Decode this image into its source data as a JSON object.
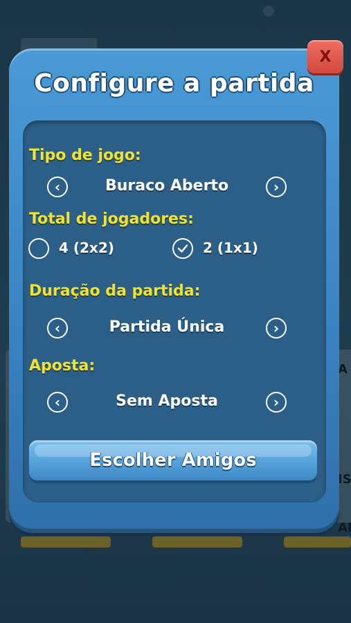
{
  "dialog": {
    "title": "Configure a partida",
    "close_label": "X",
    "game_type": {
      "label": "Tipo de jogo:",
      "value": "Buraco Aberto"
    },
    "players": {
      "label": "Total de jogadores:",
      "options": [
        {
          "label": "4 (2x2)",
          "selected": false
        },
        {
          "label": "2 (1x1)",
          "selected": true
        }
      ]
    },
    "duration": {
      "label": "Duração da partida:",
      "value": "Partida Única"
    },
    "bet": {
      "label": "Aposta:",
      "value": "Sem Aposta"
    },
    "choose_friends_label": "Escolher Amigos"
  },
  "background": {
    "right_letters": [
      "A",
      "IS",
      "AR"
    ]
  },
  "colors": {
    "dialog_blue": "#3a84c3",
    "panel_blue": "#2b5f87",
    "label_yellow": "#f2e32a",
    "close_red": "#e05a4f"
  }
}
